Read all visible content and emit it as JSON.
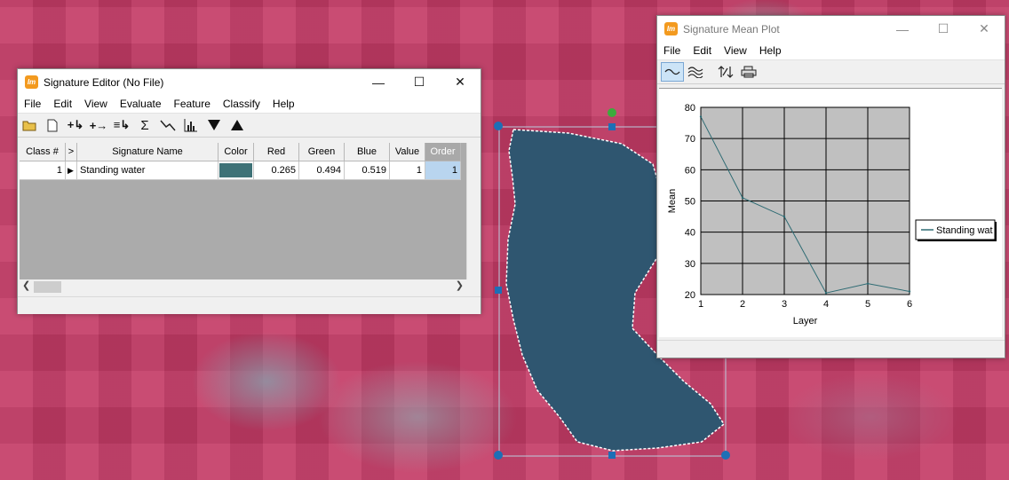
{
  "signature_editor": {
    "title": "Signature Editor (No File)",
    "menu": [
      "File",
      "Edit",
      "View",
      "Evaluate",
      "Feature",
      "Classify",
      "Help"
    ],
    "toolbar_icons": [
      "open-folder-icon",
      "new-file-icon",
      "add-signature-icon",
      "replace-signature-icon",
      "merge-signatures-icon",
      "statistics-sigma-icon",
      "mean-plot-icon",
      "histogram-icon",
      "move-down-icon",
      "move-up-icon"
    ],
    "columns": [
      "Class #",
      ">",
      "Signature Name",
      "Color",
      "Red",
      "Green",
      "Blue",
      "Value",
      "Order"
    ],
    "rows": [
      {
        "class_num": "1",
        "marker": "▶",
        "name": "Standing water",
        "color": "#3e7277",
        "red": "0.265",
        "green": "0.494",
        "blue": "0.519",
        "value": "1",
        "order": "1"
      }
    ]
  },
  "mean_plot": {
    "title": "Signature Mean Plot",
    "menu": [
      "File",
      "Edit",
      "View",
      "Help"
    ],
    "toolbar_icons": [
      "single-signature-plot-icon",
      "all-signatures-plot-icon",
      "scale-chart-icon",
      "print-icon"
    ]
  },
  "chart_data": {
    "type": "line",
    "xlabel": "Layer",
    "ylabel": "Mean",
    "x": [
      1,
      2,
      3,
      4,
      5,
      6
    ],
    "series": [
      {
        "name": "Standing wat",
        "values": [
          77,
          51,
          45,
          20.5,
          23.5,
          21
        ],
        "color": "#2e6b73"
      }
    ],
    "xlim": [
      1,
      6
    ],
    "ylim": [
      20,
      80
    ],
    "yticks": [
      "80",
      "70",
      "60",
      "50",
      "40",
      "30",
      "20"
    ],
    "xticks": [
      "1",
      "2",
      "3",
      "4",
      "5",
      "6"
    ],
    "plot_background": "#c0c0c0",
    "grid": true,
    "legend_placement": "right"
  }
}
